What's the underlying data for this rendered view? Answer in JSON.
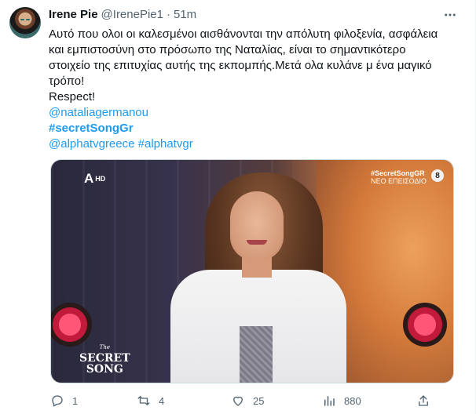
{
  "tweet": {
    "author_name": "Irene Pie",
    "handle": "@IrenePie1",
    "separator": "·",
    "time": "51m",
    "more_icon": "more-horizontal-icon",
    "text_lines": [
      "Αυτό που ολοι οι καλεσμένοι αισθάνονται την απόλυτη φιλοξενία, ασφάλεια",
      "και εμπιστοσύνη στο πρόσωπο της Ναταλίας, είναι το σημαντικότερο",
      "στοιχείο της επιτυχίας αυτής της εκπομπής.Μετά ολα κυλάνε μ ένα μαγικό",
      "τρόπο!",
      "Respect!"
    ],
    "mention": "@nataliagermanou",
    "hashtag_bold": "#secretSongGr",
    "tags_line": [
      "@alphatvgreece",
      "#alphatvgr"
    ]
  },
  "media": {
    "channel_logo": "A",
    "channel_quality": "HD",
    "show_hashtag": "#SecretSongGR",
    "show_status": "ΝΕΟ ΕΠΕΙΣΟΔΙΟ",
    "rating": "8",
    "show_logo_small": "The",
    "show_logo_line1": "SECRET",
    "show_logo_line2": "SONG"
  },
  "actions": {
    "reply_count": "1",
    "retweet_count": "4",
    "like_count": "25",
    "views_count": "880",
    "icons": [
      "reply-icon",
      "retweet-icon",
      "like-icon",
      "views-icon",
      "share-icon"
    ]
  },
  "colors": {
    "link": "#1d9bf0",
    "text": "#0f1419",
    "muted": "#536471"
  }
}
